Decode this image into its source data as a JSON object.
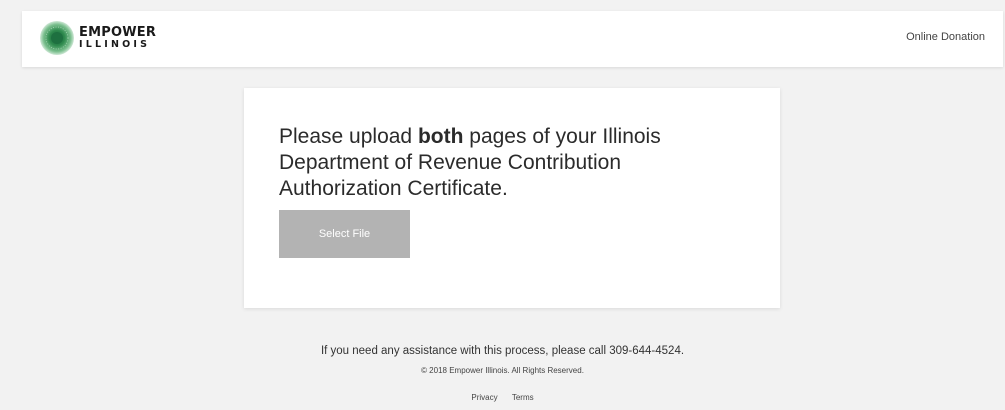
{
  "brand": {
    "name_line1": "EMPOWER",
    "name_line2": "ILLINOIS",
    "color": "#2f8a4e"
  },
  "header": {
    "nav_link": "Online Donation"
  },
  "card": {
    "heading_before": "Please upload ",
    "heading_bold": "both",
    "heading_after": " pages of your Illinois Department of Revenue Contribution Authorization Certificate.",
    "button_label": "Select File",
    "button_color": "#b3b3b3"
  },
  "footer": {
    "assistance": "If you need any assistance with this process, please call 309-644-4524.",
    "copyright": "© 2018 Empower Illinois. All Rights Reserved.",
    "links": {
      "privacy": "Privacy",
      "terms": "Terms"
    }
  }
}
